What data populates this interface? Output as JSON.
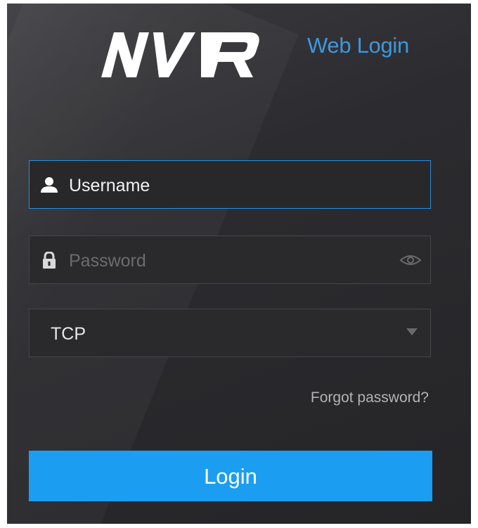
{
  "header": {
    "logo_text": "NVR",
    "title": "Web Login"
  },
  "form": {
    "username": {
      "value": "Username",
      "icon": "user-icon"
    },
    "password": {
      "placeholder": "Password",
      "icon": "lock-icon",
      "toggle_icon": "eye-icon"
    },
    "protocol": {
      "selected": "TCP",
      "icon": "caret-down-icon"
    },
    "forgot_password": "Forgot password?",
    "login_label": "Login"
  },
  "colors": {
    "accent": "#1b9ef1",
    "title": "#3d98dc",
    "focus_border": "#2a8fdd",
    "background": "#2c2c30"
  }
}
